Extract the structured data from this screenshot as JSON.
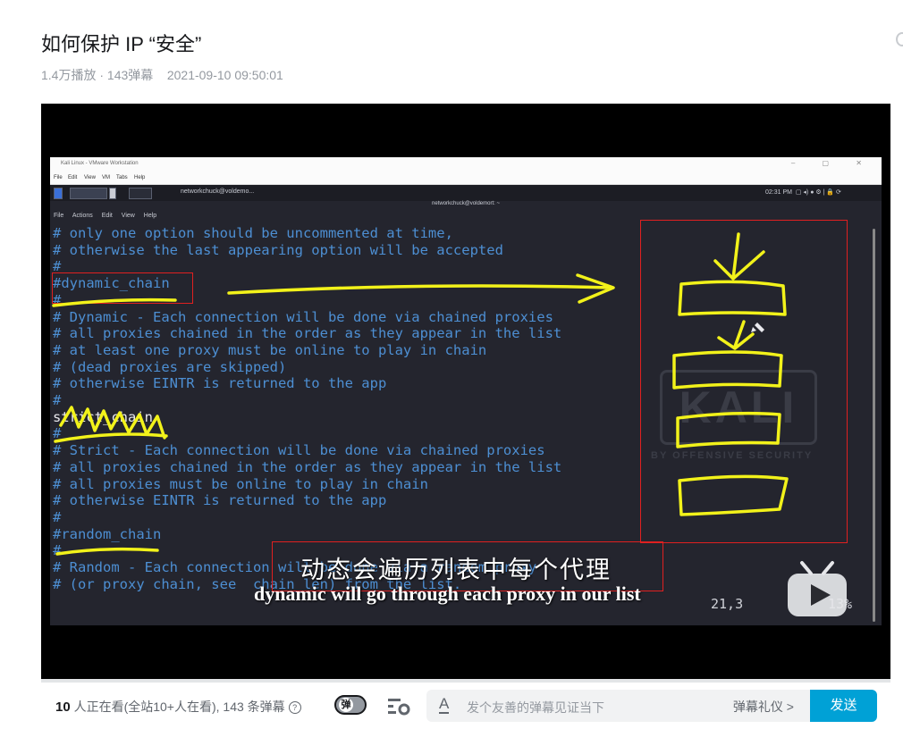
{
  "video": {
    "title": "如何保护 IP “安全”",
    "views": "1.4万播放",
    "separator": " · ",
    "danmaku_count": "143弹幕",
    "date": "2021-09-10 09:50:01"
  },
  "vm": {
    "window_title": "Kali Linux - VMware Workstation",
    "menu": [
      "File",
      "Edit",
      "View",
      "VM",
      "Tabs",
      "Help"
    ],
    "taskbar_tab": "networkchuck@voldemo...",
    "clock": "02:31 PM",
    "terminal_title": "networkchuck@voldemort: ~",
    "terminal_menu": [
      "File",
      "Actions",
      "Edit",
      "View",
      "Help"
    ]
  },
  "terminal": {
    "lines": [
      "# only one option should be uncommented at time,",
      "# otherwise the last appearing option will be accepted",
      "#",
      "#dynamic_chain",
      "#",
      "# Dynamic - Each connection will be done via chained proxies",
      "# all proxies chained in the order as they appear in the list",
      "# at least one proxy must be online to play in chain",
      "# (dead proxies are skipped)",
      "# otherwise EINTR is returned to the app",
      "#",
      "strict_chain",
      "#",
      "# Strict - Each connection will be done via chained proxies",
      "# all proxies chained in the order as they appear in the list",
      "# all proxies must be online to play in chain",
      "# otherwise EINTR is returned to the app",
      "#",
      "#random_chain",
      "#",
      "# Random - Each connection will be done via a random proxy",
      "# (or proxy chain, see  chain_len) from the list."
    ],
    "cursor_position": "21,3",
    "scroll_percent": "13%",
    "logo_text": "KALI",
    "logo_sub": "BY OFFENSIVE SECURITY"
  },
  "subtitles": {
    "zh": "动态会遍历列表中每个代理",
    "en": "dynamic will go through each proxy in our list"
  },
  "danmaku_bar": {
    "watching_count": "10",
    "watching_text": " 人正在看(全站10+人在看), 143 条弹幕",
    "toggle_label": "弹",
    "input_placeholder": "发个友善的弹幕见证当下",
    "etiquette": "弹幕礼仪 >",
    "send": "发送"
  },
  "colors": {
    "accent": "#00a1d6",
    "annotation": "#f2f21a",
    "highlight_box": "#e02020",
    "terminal_text": "#4d8fd3",
    "terminal_bg": "#24252e"
  }
}
